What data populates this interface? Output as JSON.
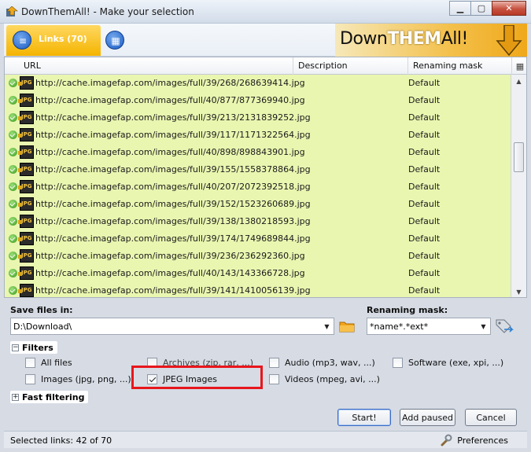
{
  "window": {
    "title": "DownThemAll! - Make your selection",
    "minimize_glyph": "▭",
    "maximize_glyph": "▢",
    "close_glyph": "✕"
  },
  "tabs": {
    "links_label": "Links (70)",
    "links_icon": "list-icon",
    "grid_icon": "grid-icon"
  },
  "logo": {
    "pre": "Down",
    "them": "THEM",
    "post": "All!"
  },
  "grid": {
    "columns": [
      "URL",
      "Description",
      "Renaming mask"
    ],
    "rows": [
      {
        "url": "http://cache.imagefap.com/images/full/39/268/268639414.jpg",
        "mask": "Default"
      },
      {
        "url": "http://cache.imagefap.com/images/full/40/877/877369940.jpg",
        "mask": "Default"
      },
      {
        "url": "http://cache.imagefap.com/images/full/39/213/2131839252.jpg",
        "mask": "Default"
      },
      {
        "url": "http://cache.imagefap.com/images/full/39/117/1171322564.jpg",
        "mask": "Default"
      },
      {
        "url": "http://cache.imagefap.com/images/full/40/898/898843901.jpg",
        "mask": "Default"
      },
      {
        "url": "http://cache.imagefap.com/images/full/39/155/1558378864.jpg",
        "mask": "Default"
      },
      {
        "url": "http://cache.imagefap.com/images/full/40/207/2072392518.jpg",
        "mask": "Default"
      },
      {
        "url": "http://cache.imagefap.com/images/full/39/152/1523260689.jpg",
        "mask": "Default"
      },
      {
        "url": "http://cache.imagefap.com/images/full/39/138/1380218593.jpg",
        "mask": "Default"
      },
      {
        "url": "http://cache.imagefap.com/images/full/39/174/1749689844.jpg",
        "mask": "Default"
      },
      {
        "url": "http://cache.imagefap.com/images/full/39/236/236292360.jpg",
        "mask": "Default"
      },
      {
        "url": "http://cache.imagefap.com/images/full/40/143/143366728.jpg",
        "mask": "Default"
      },
      {
        "url": "http://cache.imagefap.com/images/full/39/141/1410056139.jpg",
        "mask": "Default"
      }
    ]
  },
  "save": {
    "label": "Save files in:",
    "value": "D:\\Download\\"
  },
  "renaming": {
    "label": "Renaming mask:",
    "value": "*name*.*ext*"
  },
  "filters": {
    "title": "Filters",
    "items": [
      {
        "label": "All files",
        "checked": false
      },
      {
        "label": "Archives (zip, rar, ...)",
        "checked": false
      },
      {
        "label": "Audio (mp3, wav, ...)",
        "checked": false
      },
      {
        "label": "Software (exe, xpi, ...)",
        "checked": false
      },
      {
        "label": "Images (jpg, png, ...)",
        "checked": false
      },
      {
        "label": "JPEG Images",
        "checked": true
      },
      {
        "label": "Videos (mpeg, avi, ...)",
        "checked": false
      }
    ]
  },
  "fast_filtering": {
    "title": "Fast filtering"
  },
  "buttons": {
    "start": "Start!",
    "add_paused": "Add paused",
    "cancel": "Cancel"
  },
  "status": {
    "selected": "Selected links: 42 of 70",
    "preferences": "Preferences"
  },
  "colors": {
    "grid_bg": "#e9f6b0",
    "tab_accent": "#f4b400",
    "highlight": "#e8161c"
  }
}
